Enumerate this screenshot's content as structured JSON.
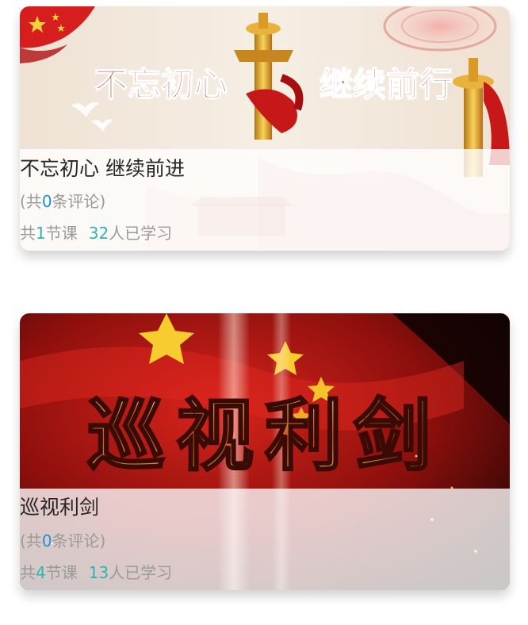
{
  "courses": [
    {
      "banner_text_left": "不忘初心",
      "banner_text_right": "继续前行",
      "title": "不忘初心 继续前进",
      "comments_prefix": "(共",
      "comments_count": "0",
      "comments_suffix": "条评论)",
      "lessons_prefix": "共",
      "lessons_count": "1",
      "lessons_suffix": "节课",
      "learners_count": "32",
      "learners_suffix": "人已学习"
    },
    {
      "banner_text": "巡视利剑",
      "title": "巡视利剑",
      "comments_prefix": "(共",
      "comments_count": "0",
      "comments_suffix": "条评论)",
      "lessons_prefix": "共",
      "lessons_count": "4",
      "lessons_suffix": "节课",
      "learners_count": "13",
      "learners_suffix": "人已学习"
    }
  ],
  "colors": {
    "title": "#262626",
    "meta": "#9a9a9a",
    "comment_count": "#1a93d6",
    "stat_count": "#2fb3b6"
  }
}
